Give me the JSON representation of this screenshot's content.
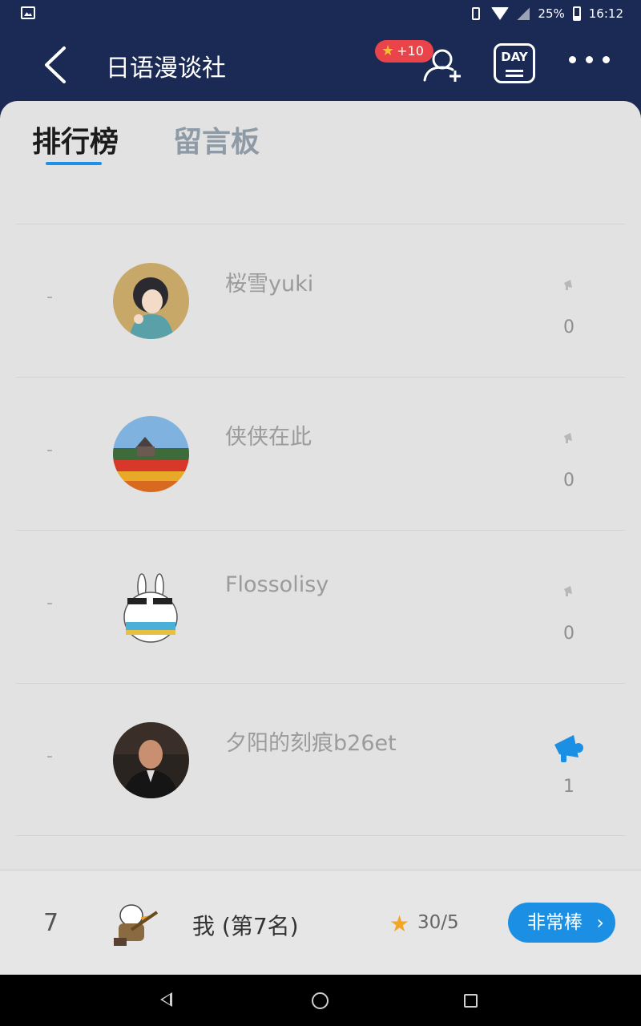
{
  "status_bar": {
    "battery": "25%",
    "time": "16:12",
    "icons": [
      "gallery-icon",
      "vibrate-icon",
      "wifi-icon",
      "no-signal-icon",
      "battery-icon"
    ]
  },
  "header": {
    "title": "日语漫谈社",
    "badge": "+10",
    "day_label": "DAY",
    "icons": [
      "back-icon",
      "star-icon",
      "add-user-icon",
      "day-icon",
      "more-icon"
    ]
  },
  "tabs": [
    {
      "label": "排行榜",
      "active": true
    },
    {
      "label": "留言板",
      "active": false
    }
  ],
  "rows": [
    {
      "rank": "-",
      "name": "桜雪yuki",
      "count": "0",
      "highlight": false
    },
    {
      "rank": "-",
      "name": "侠侠在此",
      "count": "0",
      "highlight": false
    },
    {
      "rank": "-",
      "name": "Flossolisy",
      "count": "0",
      "highlight": false
    },
    {
      "rank": "-",
      "name": "夕阳的刻痕b26et",
      "count": "1",
      "highlight": true
    }
  ],
  "me": {
    "rank": "7",
    "name": "我 (第7名)",
    "score": "30/5",
    "button": "非常棒"
  },
  "colors": {
    "header_bg": "#1b2a55",
    "accent": "#1b8fe4",
    "badge": "#e8444a",
    "star": "#f3a623"
  }
}
